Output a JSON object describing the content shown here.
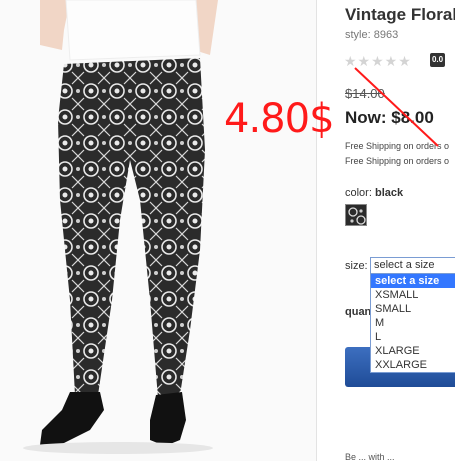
{
  "product": {
    "title": "Vintage Floral",
    "style": "style: 8963",
    "rating_badge": "0.0",
    "stars": "★★★★★",
    "was_price": "$14.00",
    "now_price": "Now: $8.00",
    "handwritten_price": "4.80$",
    "shipping_1": "Free Shipping on orders o",
    "shipping_2": "Free Shipping on orders o"
  },
  "color": {
    "label": "color:",
    "value": "black"
  },
  "size": {
    "label": "size:",
    "selected": "select a size",
    "options": [
      "select a size",
      "XSMALL",
      "SMALL",
      "M",
      "L",
      "XLARGE",
      "XXLARGE"
    ]
  },
  "quantity": {
    "label": "quan"
  },
  "bottom_text": "Be ... with ... ",
  "colors": {
    "annotation_red": "#ff1a1a",
    "highlight_blue": "#3377ff",
    "button_blue": "#2a5aa8"
  },
  "icons": [
    "leggings-photo",
    "star-icon",
    "color-swatch-icon",
    "dropdown-arrow-icon"
  ]
}
